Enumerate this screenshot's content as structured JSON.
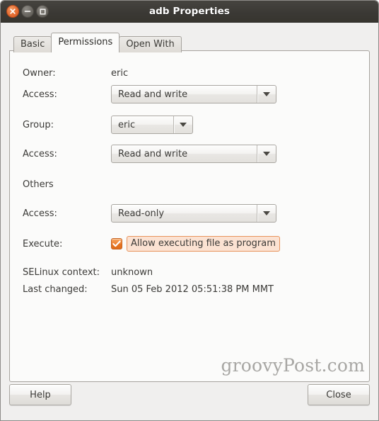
{
  "window": {
    "title": "adb Properties",
    "buttons": {
      "close": "close-window",
      "minimize": "minimize-window",
      "maximize": "maximize-window"
    }
  },
  "tabs": [
    {
      "label": "Basic",
      "active": false
    },
    {
      "label": "Permissions",
      "active": true
    },
    {
      "label": "Open With",
      "active": false
    }
  ],
  "permissions": {
    "owner": {
      "label": "Owner:",
      "value": "eric"
    },
    "owner_access": {
      "label": "Access:",
      "value": "Read and write"
    },
    "group": {
      "label": "Group:",
      "value": "eric"
    },
    "group_access": {
      "label": "Access:",
      "value": "Read and write"
    },
    "others": {
      "label": "Others"
    },
    "others_access": {
      "label": "Access:",
      "value": "Read-only"
    },
    "execute": {
      "label": "Execute:",
      "checkbox_label": "Allow executing file as program",
      "checked": true
    },
    "selinux": {
      "label": "SELinux context:",
      "value": "unknown"
    },
    "last_changed": {
      "label": "Last changed:",
      "value": "Sun 05 Feb 2012 05:51:38 PM MMT"
    }
  },
  "watermark": "groovyPost.com",
  "actions": {
    "help": "Help",
    "close": "Close"
  },
  "colors": {
    "titlebar": "#3b3935",
    "accent_orange": "#e67523",
    "highlight_fill": "#fbe2d2",
    "highlight_border": "#e8945c",
    "panel": "#fbfbfa",
    "window_bg": "#f0efee"
  }
}
